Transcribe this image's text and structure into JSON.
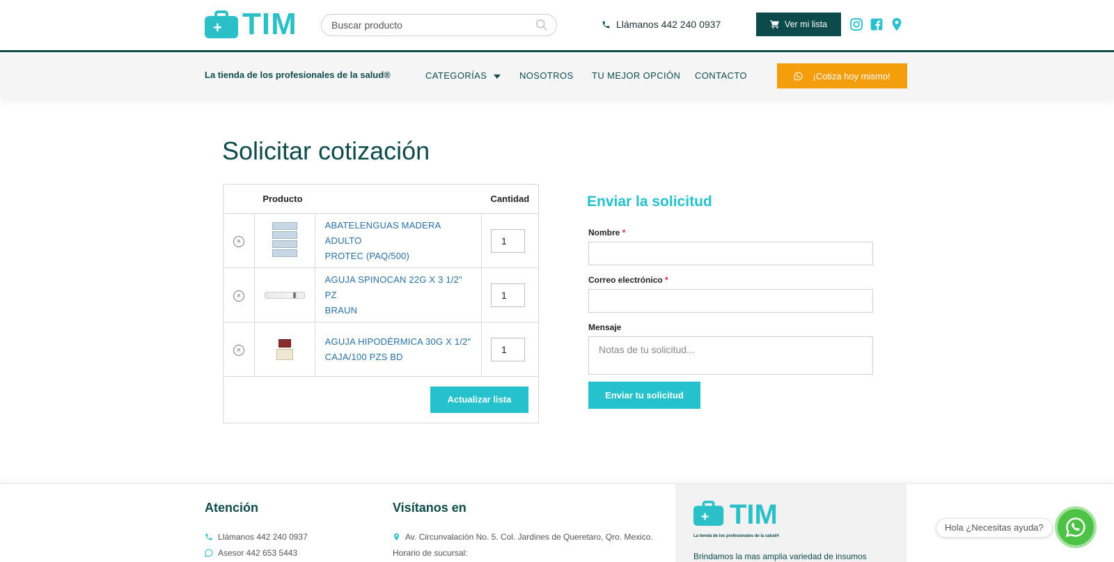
{
  "header": {
    "logo_text": "TIM",
    "search_placeholder": "Buscar producto",
    "phone_label": "Llámanos 442 240 0937",
    "list_button": "Ver mi lista",
    "social_icons": [
      "instagram-icon",
      "facebook-icon",
      "map-pin-icon"
    ]
  },
  "nav": {
    "tagline": "La tienda de los profesionales de la salud®",
    "items": [
      "CATEGORÍAS",
      "NOSOTROS",
      "TU MEJOR OPCIÓN",
      "CONTACTO"
    ],
    "cta": "¡Cotiza hoy mismo!"
  },
  "main": {
    "title": "Solicitar cotización",
    "table": {
      "headers": [
        "Producto",
        "Cantidad"
      ],
      "rows": [
        {
          "name_line1": "ABATELENGUAS MADERA ADULTO",
          "name_line2": "PROTEC (PAQ/500)",
          "qty": "1"
        },
        {
          "name_line1": "AGUJA SPINOCAN 22G X 3 1/2\" PZ",
          "name_line2": "BRAUN",
          "qty": "1"
        },
        {
          "name_line1": "AGUJA HIPODÉRMICA 30G X 1/2\"",
          "name_line2": "CAJA/100 PZS BD",
          "qty": "1"
        }
      ],
      "update_button": "Actualizar lista"
    },
    "form": {
      "title": "Enviar la solicitud",
      "name_label": "Nombre",
      "email_label": "Correo electrónico",
      "required_mark": "*",
      "message_label": "Mensaje",
      "message_placeholder": "Notas de tu solicitud...",
      "submit": "Enviar tu solicitud"
    }
  },
  "footer": {
    "attention_title": "Atención",
    "attention_phone": "Llámanos 442 240 0937",
    "attention_advisor": "Asesor 442 653 5443",
    "visit_title": "Visítanos en",
    "address": "Av. Circunvalación No. 5. Col. Jardines de Queretaro, Qro. Mexico.",
    "hours_label": "Horario de sucursal:",
    "logo_text": "TIM",
    "logo_tagline": "La tienda de los profesionales de la salud®",
    "description": "Brindamos la mas amplia variedad de insumos"
  },
  "whatsapp": {
    "bubble": "Hola ¿Necesitas ayuda?"
  },
  "colors": {
    "brand_dark": "#0d4a4c",
    "brand_teal": "#25c1cc",
    "cta_orange": "#f59e0b",
    "link_blue": "#2a6fa8",
    "whatsapp_green": "#4dc247"
  }
}
